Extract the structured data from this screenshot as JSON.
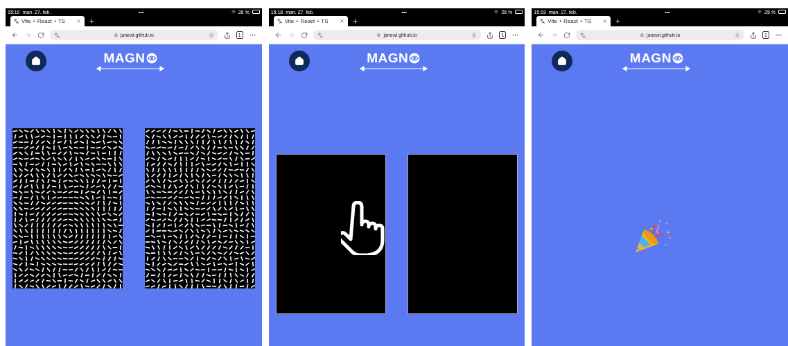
{
  "screens": [
    {
      "status": {
        "time": "15:19",
        "date": "man. 27. feb.",
        "dots": "•••",
        "battery": "26 %"
      },
      "tab": {
        "title": "Vite + React + TS"
      },
      "url": "janewl.github.io",
      "tab_count": "1",
      "logo": "MAGN",
      "kind": "patterns"
    },
    {
      "status": {
        "time": "15:18",
        "date": "man. 27. feb.",
        "dots": "•••",
        "battery": "26 %"
      },
      "tab": {
        "title": "Vite + React + TS"
      },
      "url": "janewl.github.io",
      "tab_count": "1",
      "logo": "MAGN",
      "kind": "choice"
    },
    {
      "status": {
        "time": "15:19",
        "date": "man. 27. feb.",
        "dots": "•••",
        "battery": "25 %"
      },
      "tab": {
        "title": "Vite + React + TS"
      },
      "url": "janewl.github.io",
      "tab_count": "1",
      "logo": "MAGN",
      "kind": "celebration"
    }
  ]
}
